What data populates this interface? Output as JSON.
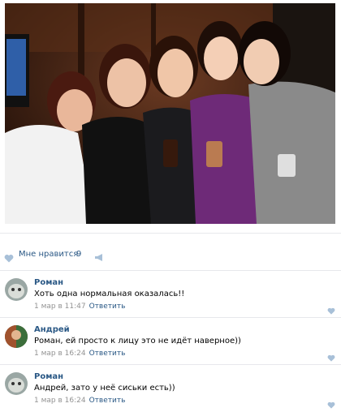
{
  "post": {
    "photo_icon": "photo-image",
    "likes": {
      "label": "Мне нравится",
      "count": "9",
      "icon": "heart-icon"
    },
    "share_icon": "megaphone-icon"
  },
  "comments": [
    {
      "author": "Роман",
      "text": "Хоть одна нормальная оказалась!!",
      "date": "1 мар в 11:47",
      "reply": "Ответить"
    },
    {
      "author": "Андрей",
      "text": "Роман, ей просто к лицу это не идёт наверное))",
      "date": "1 мар в 16:24",
      "reply": "Ответить"
    },
    {
      "author": "Роман",
      "text": "Андрей, зато у неё сиськи есть))",
      "date": "1 мар в 16:24",
      "reply": "Ответить"
    }
  ],
  "colors": {
    "link": "#2a5885",
    "meta": "#939393",
    "divider": "#e7e8ec",
    "heart": "#a8c0d8"
  }
}
